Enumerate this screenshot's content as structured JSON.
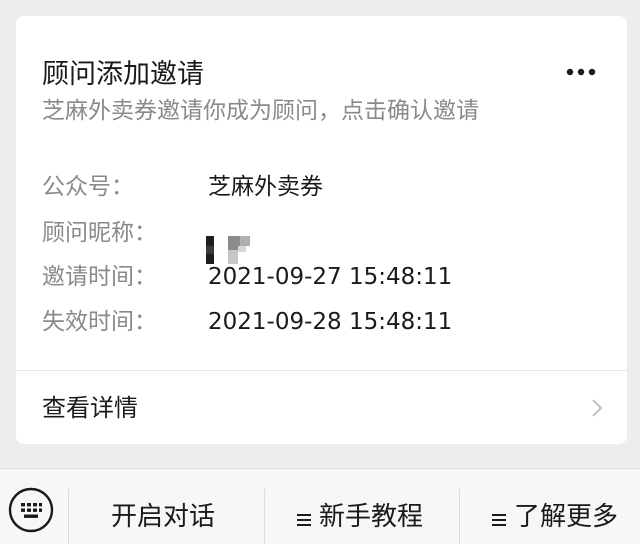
{
  "card": {
    "title": "顾问添加邀请",
    "description": "芝麻外卖券邀请你成为顾问，点击确认邀请",
    "info": {
      "account_label": "公众号：",
      "account_value": "芝麻外卖券",
      "nickname_label": "顾问昵称：",
      "invite_time_label": "邀请时间：",
      "invite_time_value": "2021-09-27  15:48:11",
      "expire_time_label": "失效时间：",
      "expire_time_value": "2021-09-28  15:48:11"
    },
    "detail_label": "查看详情",
    "more_icon": "more-dots-icon",
    "chevron_icon": "chevron-right-icon"
  },
  "menu": {
    "keyboard_icon": "keyboard-icon",
    "menu_icon": "menu-lines-icon",
    "items": [
      {
        "label": "开启对话",
        "has_menu_icon": false
      },
      {
        "label": "新手教程",
        "has_menu_icon": true
      },
      {
        "label": "了解更多",
        "has_menu_icon": true
      }
    ]
  }
}
